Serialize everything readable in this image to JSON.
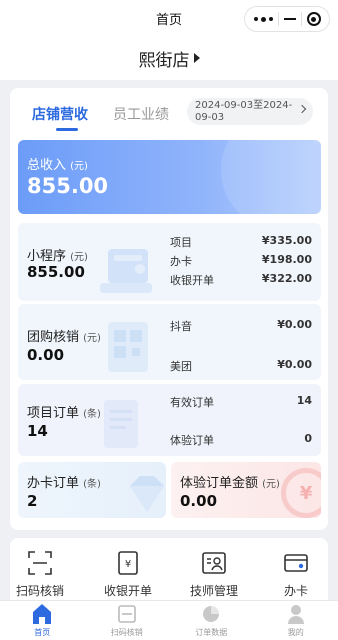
{
  "statusbar": {
    "title": "首页"
  },
  "store": {
    "name": "熙街店"
  },
  "tabs": [
    {
      "label": "店铺营收",
      "active": true
    },
    {
      "label": "员工业绩",
      "active": false
    }
  ],
  "date_range": {
    "line1": "2024-09-03至2024-",
    "line2": "09-03"
  },
  "total": {
    "label": "总收入",
    "unit": "(元)",
    "value": "855.00"
  },
  "mini_program": {
    "label": "小程序",
    "unit": "(元)",
    "value": "855.00",
    "rows": [
      {
        "name": "项目",
        "amount": "¥335.00"
      },
      {
        "name": "办卡",
        "amount": "¥198.00"
      },
      {
        "name": "收银开单",
        "amount": "¥322.00"
      }
    ]
  },
  "group_buy": {
    "label": "团购核销",
    "unit": "(元)",
    "value": "0.00",
    "rows": [
      {
        "name": "抖音",
        "amount": "¥0.00"
      },
      {
        "name": "美团",
        "amount": "¥0.00"
      }
    ]
  },
  "project_orders": {
    "label": "项目订单",
    "unit": "(条)",
    "value": "14",
    "rows": [
      {
        "name": "有效订单",
        "amount": "14"
      },
      {
        "name": "体验订单",
        "amount": "0"
      }
    ]
  },
  "card_orders": {
    "label": "办卡订单",
    "unit": "(条)",
    "value": "2"
  },
  "trial_amount": {
    "label": "体验订单金额",
    "unit": "(元)",
    "value": "0.00"
  },
  "quick_actions": [
    {
      "label": "扫码核销",
      "icon": "scan-icon"
    },
    {
      "label": "收银开单",
      "icon": "cashier-icon"
    },
    {
      "label": "技师管理",
      "icon": "technician-icon"
    },
    {
      "label": "办卡",
      "icon": "card-icon"
    }
  ],
  "tabbar": [
    {
      "label": "首页",
      "icon": "home-icon",
      "active": true
    },
    {
      "label": "扫码核销",
      "icon": "scan-icon",
      "active": false
    },
    {
      "label": "订单数据",
      "icon": "pie-chart-icon",
      "active": false
    },
    {
      "label": "我的",
      "icon": "user-icon",
      "active": false
    }
  ],
  "colors": {
    "accent": "#2d6ae0",
    "total_card": "#7ea8f9",
    "inactive": "#999999"
  }
}
